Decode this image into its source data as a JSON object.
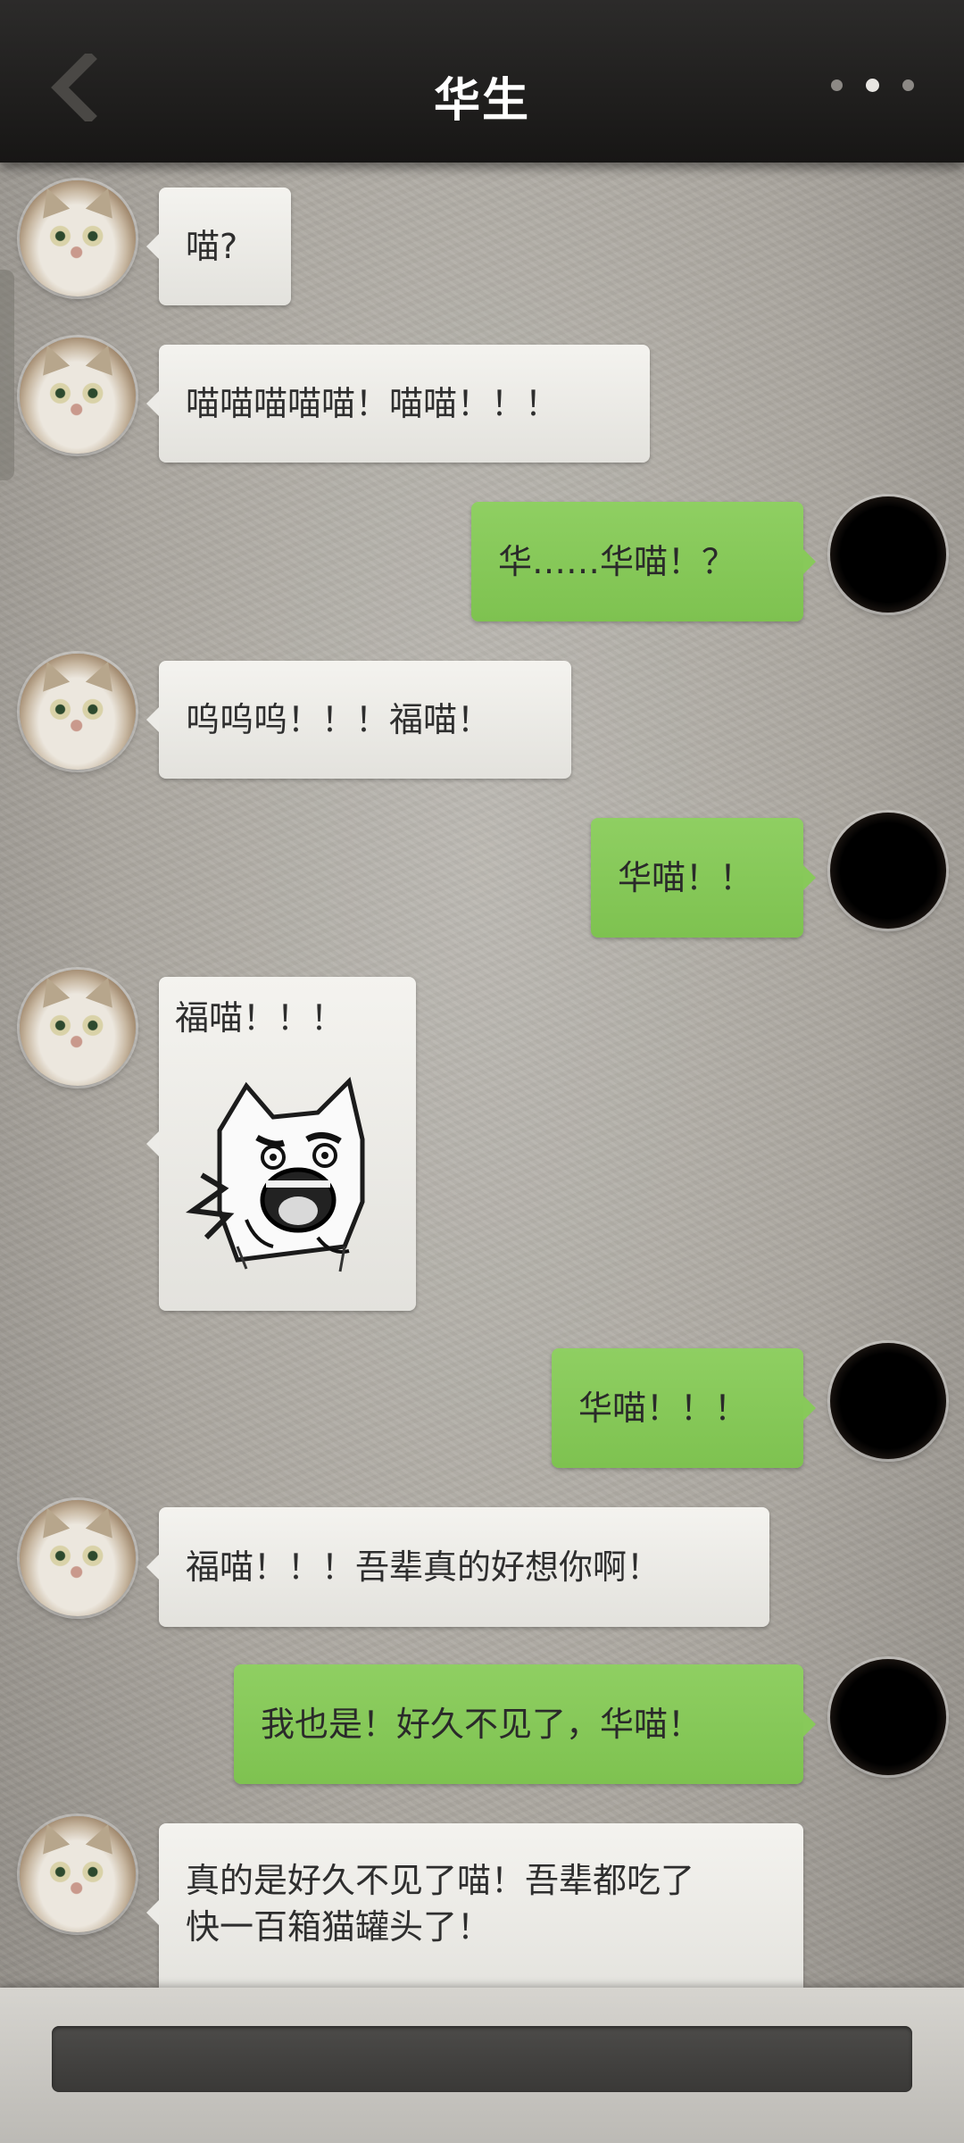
{
  "header": {
    "title": "华生"
  },
  "messages": [
    {
      "side": "left",
      "text": "喵?"
    },
    {
      "side": "left",
      "text": "喵喵喵喵喵！喵喵！！！"
    },
    {
      "side": "right",
      "text": "华……华喵！？"
    },
    {
      "side": "left",
      "text": "呜呜呜！！！福喵！"
    },
    {
      "side": "right",
      "text": "华喵！！"
    },
    {
      "side": "left",
      "text": "福喵！！！",
      "sticker": "screaming-cat-sticker"
    },
    {
      "side": "right",
      "text": "华喵！！！"
    },
    {
      "side": "left",
      "text": "福喵！！！吾辈真的好想你啊！"
    },
    {
      "side": "right",
      "text": "我也是！好久不见了，华喵！"
    },
    {
      "side": "left",
      "text_lines": [
        "真的是好久不见了喵！吾辈都吃了",
        "快一百箱猫罐头了！"
      ]
    }
  ],
  "icons": {
    "back": "chevron-left-icon",
    "more": "more-dots-icon",
    "left_avatar": "cat-avatar",
    "right_avatar": "dark-avatar"
  },
  "colors": {
    "header": "#1f1e1d",
    "right_bubble": "#86c75a",
    "left_bubble": "#ecebe7",
    "background": "#b1ada6"
  }
}
